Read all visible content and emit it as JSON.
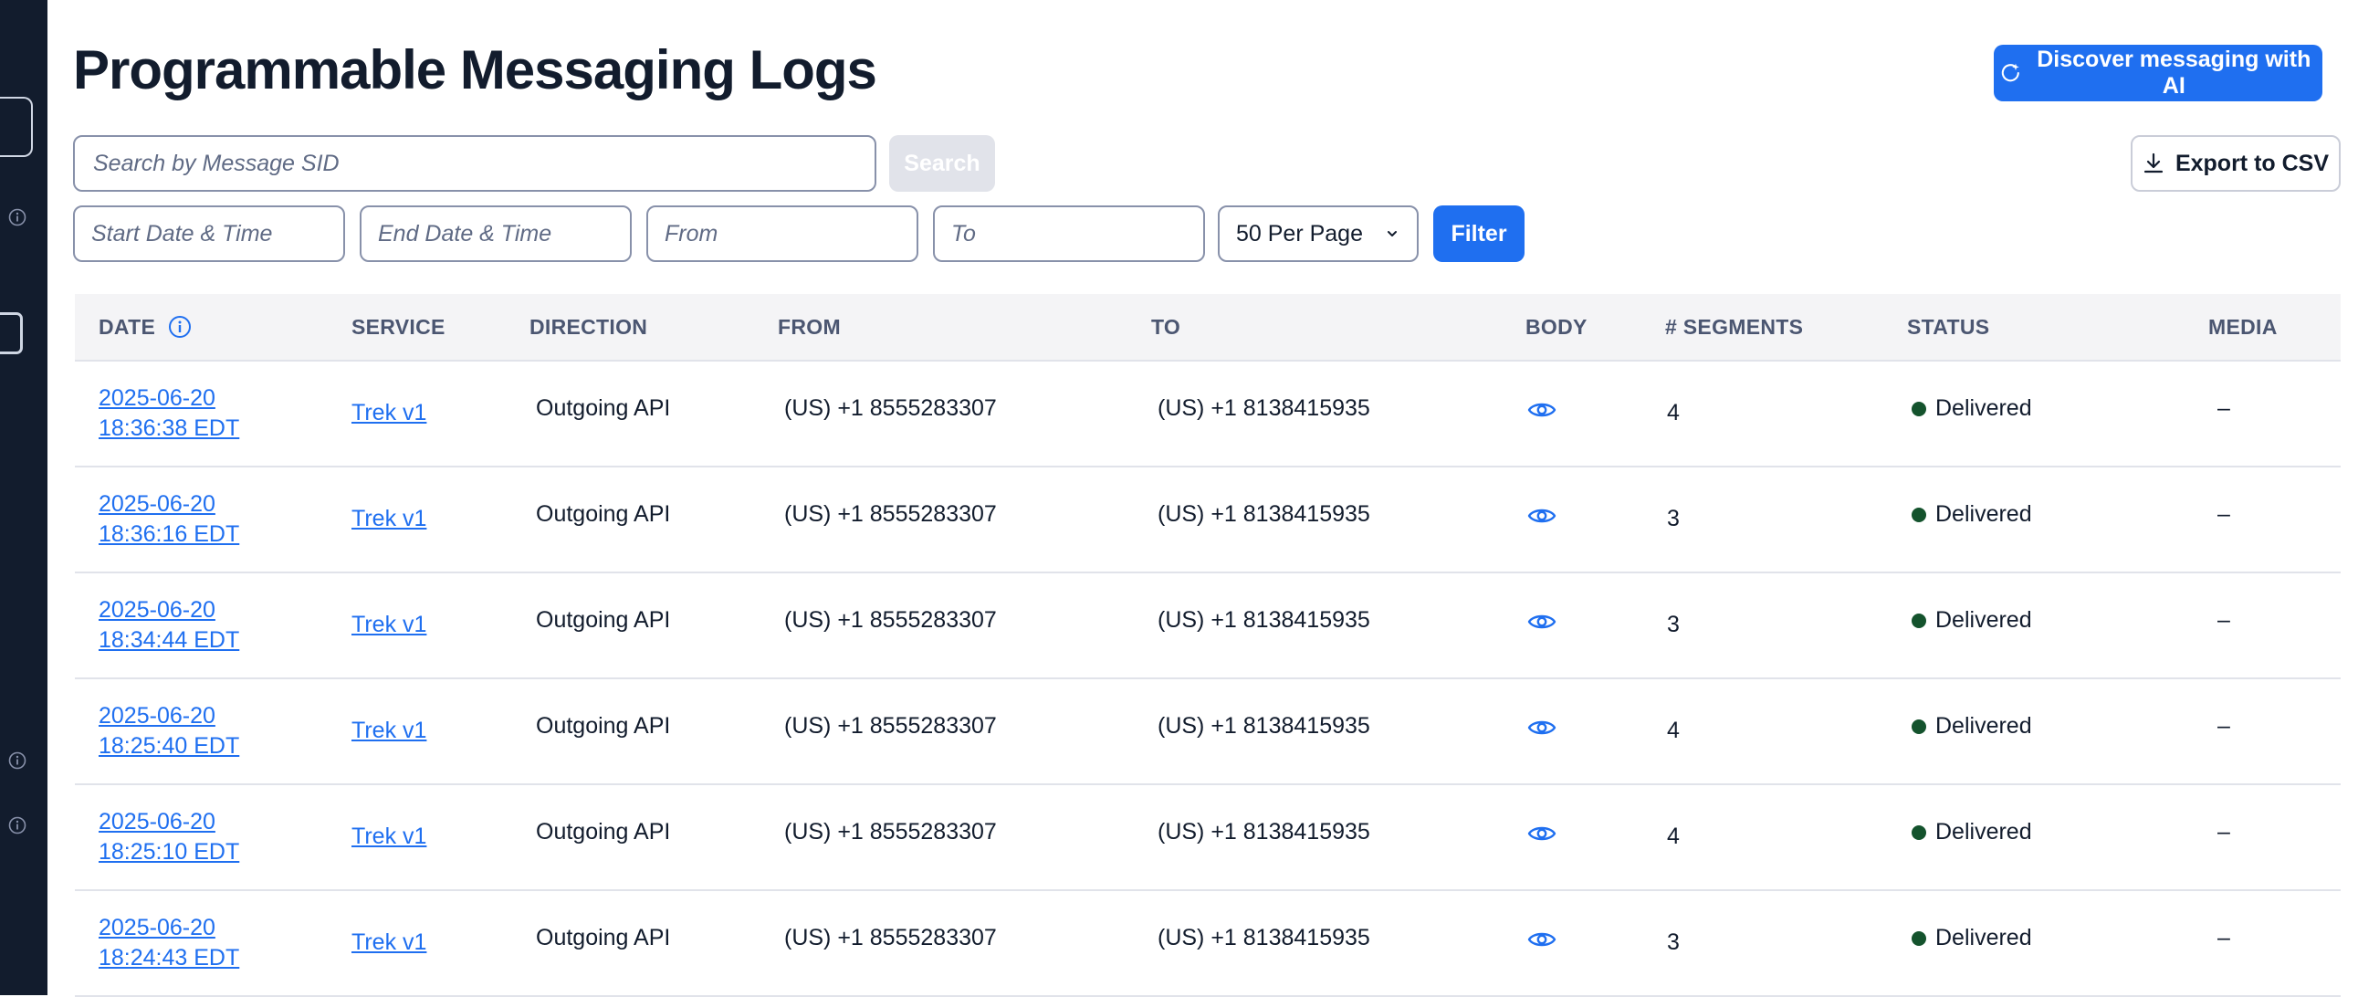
{
  "page": {
    "title": "Programmable Messaging Logs"
  },
  "header": {
    "ai_button_label": "Discover messaging with AI",
    "export_label": "Export to CSV"
  },
  "search": {
    "placeholder": "Search by Message SID",
    "button_label": "Search"
  },
  "filters": {
    "start_placeholder": "Start Date & Time",
    "end_placeholder": "End Date & Time",
    "from_placeholder": "From",
    "to_placeholder": "To",
    "per_page_value": "50 Per Page",
    "filter_label": "Filter"
  },
  "table": {
    "headers": {
      "date": "DATE",
      "service": "SERVICE",
      "direction": "DIRECTION",
      "from": "FROM",
      "to": "TO",
      "body": "BODY",
      "segments": "# SEGMENTS",
      "status": "STATUS",
      "media": "MEDIA"
    },
    "rows": [
      {
        "date": "2025-06-20",
        "time": "18:36:38 EDT",
        "service": "Trek v1",
        "direction": "Outgoing API",
        "from": "(US) +1 8555283307",
        "to": "(US) +1 8138415935",
        "segments": "4",
        "status": "Delivered",
        "media": "–"
      },
      {
        "date": "2025-06-20",
        "time": "18:36:16 EDT",
        "service": "Trek v1",
        "direction": "Outgoing API",
        "from": "(US) +1 8555283307",
        "to": "(US) +1 8138415935",
        "segments": "3",
        "status": "Delivered",
        "media": "–"
      },
      {
        "date": "2025-06-20",
        "time": "18:34:44 EDT",
        "service": "Trek v1",
        "direction": "Outgoing API",
        "from": "(US) +1 8555283307",
        "to": "(US) +1 8138415935",
        "segments": "3",
        "status": "Delivered",
        "media": "–"
      },
      {
        "date": "2025-06-20",
        "time": "18:25:40 EDT",
        "service": "Trek v1",
        "direction": "Outgoing API",
        "from": "(US) +1 8555283307",
        "to": "(US) +1 8138415935",
        "segments": "4",
        "status": "Delivered",
        "media": "–"
      },
      {
        "date": "2025-06-20",
        "time": "18:25:10 EDT",
        "service": "Trek v1",
        "direction": "Outgoing API",
        "from": "(US) +1 8555283307",
        "to": "(US) +1 8138415935",
        "segments": "4",
        "status": "Delivered",
        "media": "–"
      },
      {
        "date": "2025-06-20",
        "time": "18:24:43 EDT",
        "service": "Trek v1",
        "direction": "Outgoing API",
        "from": "(US) +1 8555283307",
        "to": "(US) +1 8138415935",
        "segments": "3",
        "status": "Delivered",
        "media": "–"
      }
    ]
  },
  "colors": {
    "accent": "#1f6ff0",
    "sidebar": "#121c2d",
    "status_delivered": "#14532d"
  }
}
